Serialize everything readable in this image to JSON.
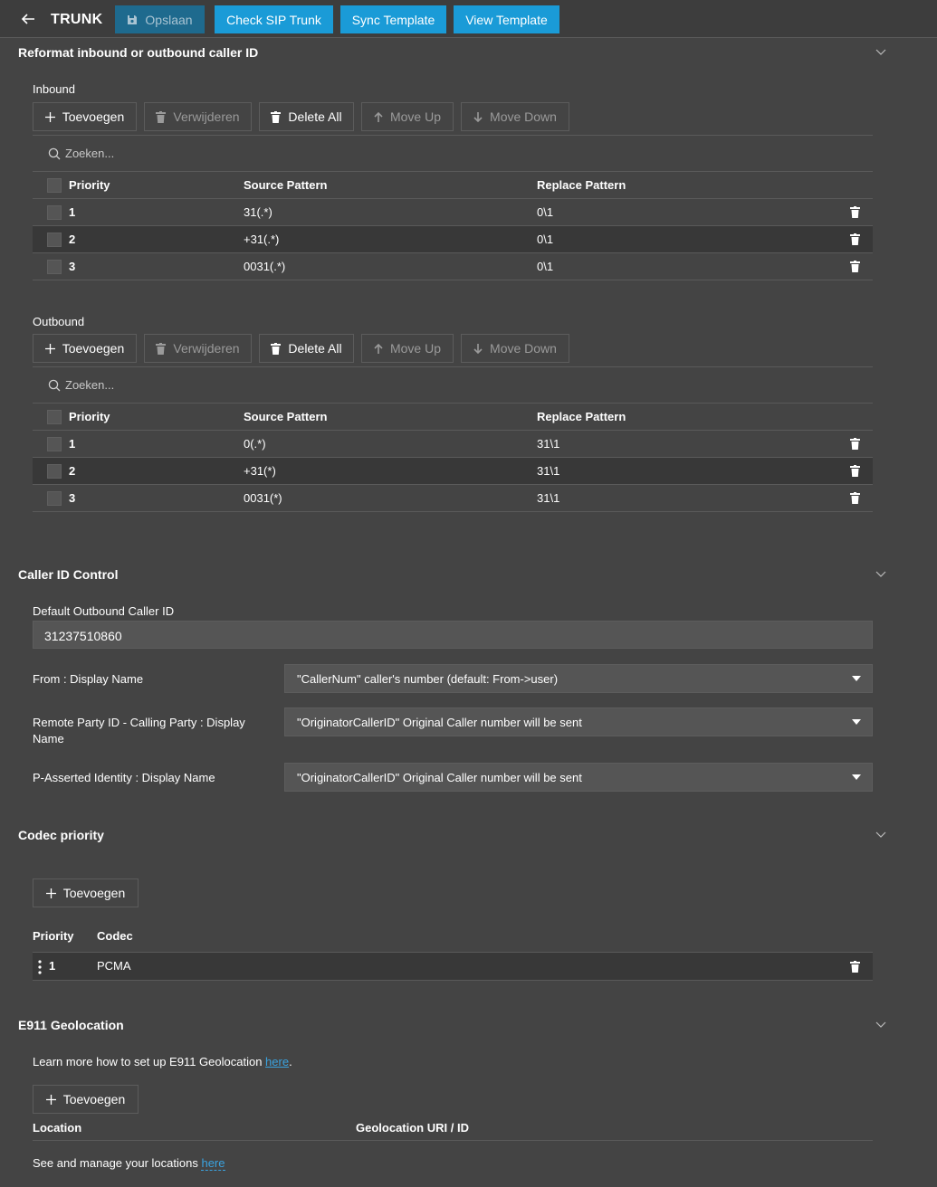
{
  "topbar": {
    "title": "TRUNK",
    "save_label": "Opslaan",
    "check_label": "Check SIP Trunk",
    "sync_label": "Sync Template",
    "view_label": "View Template"
  },
  "reformat": {
    "title": "Reformat inbound or outbound caller ID",
    "inbound": {
      "label": "Inbound",
      "add": "Toevoegen",
      "remove": "Verwijderen",
      "delete_all": "Delete All",
      "move_up": "Move Up",
      "move_down": "Move Down",
      "search_placeholder": "Zoeken...",
      "columns": [
        "Priority",
        "Source Pattern",
        "Replace Pattern"
      ],
      "rows": [
        {
          "priority": "1",
          "source": "31(.*)",
          "replace": "0\\1"
        },
        {
          "priority": "2",
          "source": "+31(.*)",
          "replace": "0\\1"
        },
        {
          "priority": "3",
          "source": "0031(.*)",
          "replace": "0\\1"
        }
      ]
    },
    "outbound": {
      "label": "Outbound",
      "add": "Toevoegen",
      "remove": "Verwijderen",
      "delete_all": "Delete All",
      "move_up": "Move Up",
      "move_down": "Move Down",
      "search_placeholder": "Zoeken...",
      "columns": [
        "Priority",
        "Source Pattern",
        "Replace Pattern"
      ],
      "rows": [
        {
          "priority": "1",
          "source": "0(.*)",
          "replace": "31\\1"
        },
        {
          "priority": "2",
          "source": "+31(*)",
          "replace": "31\\1"
        },
        {
          "priority": "3",
          "source": "0031(*)",
          "replace": "31\\1"
        }
      ]
    }
  },
  "caller_id": {
    "title": "Caller ID Control",
    "default_label": "Default Outbound Caller ID",
    "default_value": "31237510860",
    "from_label": "From : Display Name",
    "from_value": "\"CallerNum\" caller's number (default: From->user)",
    "rpid_label_line1": "Remote Party ID - Calling Party : Display",
    "rpid_label_line2": "Name",
    "rpid_value": "\"OriginatorCallerID\" Original Caller number will be sent",
    "pai_label": "P-Asserted Identity : Display Name",
    "pai_value": "\"OriginatorCallerID\" Original Caller number will be sent"
  },
  "codec": {
    "title": "Codec priority",
    "add": "Toevoegen",
    "col_priority": "Priority",
    "col_codec": "Codec",
    "rows": [
      {
        "priority": "1",
        "codec": "PCMA"
      }
    ]
  },
  "e911": {
    "title": "E911 Geolocation",
    "learn_prefix": "Learn more how to set up E911 Geolocation ",
    "learn_link": "here",
    "learn_suffix": ".",
    "add": "Toevoegen",
    "col_location": "Location",
    "col_uri": "Geolocation URI / ID",
    "manage_prefix": "See and manage your locations ",
    "manage_link": "here"
  },
  "icons": [
    "back-arrow-icon",
    "save-icon",
    "plus-icon",
    "trash-icon",
    "arrow-up-icon",
    "arrow-down-icon",
    "search-icon",
    "chevron-down-icon",
    "caret-down-icon",
    "drag-handle-icon"
  ]
}
